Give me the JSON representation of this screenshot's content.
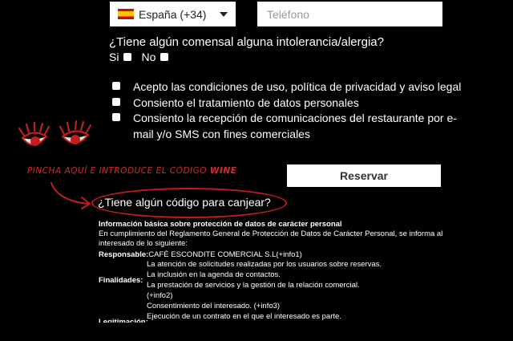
{
  "phone": {
    "country": "España (+34)",
    "placeholder": "Teléfono"
  },
  "allergy": {
    "question": "¿Tiene algún comensal alguna intolerancia/alergia?",
    "yes": "Si",
    "no": "No"
  },
  "consents": [
    "Acepto las condiciones de uso, política de privacidad y aviso legal",
    "Consiento el tratamiento de datos personales",
    "Consiento la recepción de comunicaciones del restaurante por e-",
    "mail y/o SMS con fines comerciales"
  ],
  "reserve_label": "Reservar",
  "promo": {
    "text": "PINCHA AQUÍ E INTRODUCE EL CÓDIGO",
    "code": "WINE"
  },
  "coupon_link": "¿Tiene algún código para canjear?",
  "data_info": {
    "title": "Información básica sobre protección de datos de carácter personal",
    "intro": "En cumplimiento del Reglamento General de Protección de Datos de Carácter Personal, se informa al interesado de lo siguiente:",
    "responsable_label": "Responsable:",
    "responsable_value": "CAFÉ ESCONDITE COMERCIAL S.L(+info1)",
    "finalidades_label": "Finalidades:",
    "finalidades": [
      "La atención de solicitudes realizadas por los usuarios sobre reservas.",
      "La inclusión en la agenda de contactos.",
      "La prestación de servicios y la gestión de la relación comercial.",
      "(+info2)",
      "Consentimiento del interesado. (+info3)",
      "Ejecución de un contrato en el que el interesado es parte."
    ],
    "legitimacion_label": "Legitimación:"
  },
  "colors": {
    "accent_red": "#c41d1d",
    "background": "#000000"
  },
  "icons": [
    "spain-flag-icon",
    "chevron-down-icon",
    "eyes-drawing-icon",
    "arrow-doodle-icon"
  ]
}
